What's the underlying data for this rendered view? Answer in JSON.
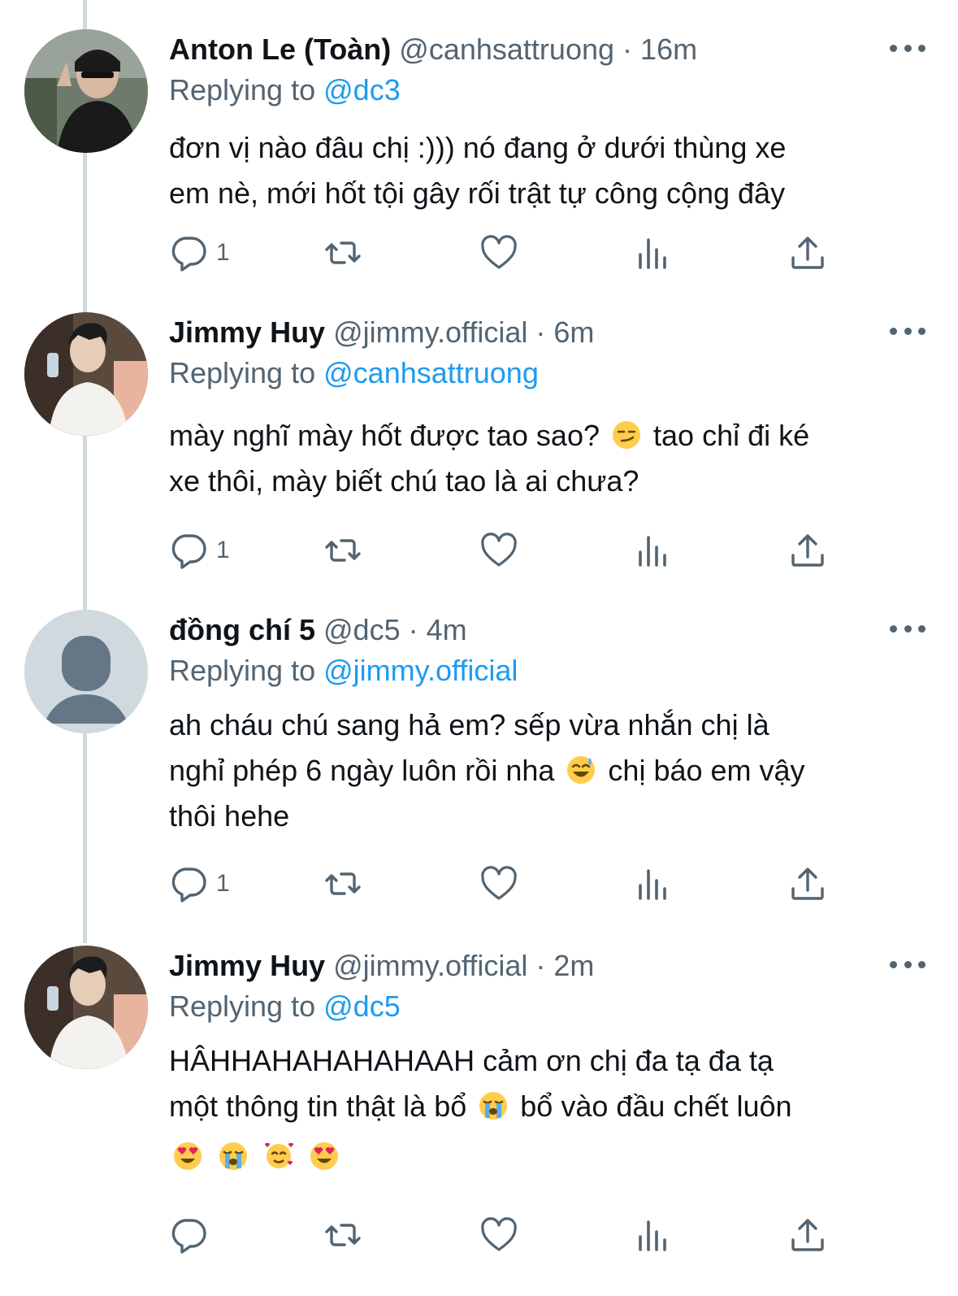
{
  "tweets": [
    {
      "name": "Anton Le (Toàn)",
      "handle": "@canhsattruong",
      "separator": "·",
      "time": "16m",
      "replying_prefix": "Replying to",
      "replying_to": "@dc3",
      "lines": [
        "đơn vị nào đâu chị :))) nó đang ở dưới thùng xe",
        "em nè, mới hốt tội gây rối trật tự công cộng đây"
      ],
      "reply_count": "1",
      "avatar": "photo"
    },
    {
      "name": "Jimmy Huy",
      "handle": "@jimmy.official",
      "separator": "·",
      "time": "6m",
      "replying_prefix": "Replying to",
      "replying_to": "@canhsattruong",
      "lines": [
        "mày nghĩ mày hốt được tao sao?",
        "tao chỉ đi ké",
        "xe thôi, mày biết chú tao là ai chưa?"
      ],
      "reply_count": "1",
      "avatar": "photo"
    },
    {
      "name": "đồng chí 5",
      "handle": "@dc5",
      "separator": "·",
      "time": "4m",
      "replying_prefix": "Replying to",
      "replying_to": "@jimmy.official",
      "lines": [
        "ah cháu chú sang hả em? sếp vừa nhắn chị là",
        "nghỉ phép 6 ngày luôn rồi nha",
        "chị báo em vậy",
        "thôi hehe"
      ],
      "reply_count": "1",
      "avatar": "default"
    },
    {
      "name": "Jimmy Huy",
      "handle": "@jimmy.official",
      "separator": "·",
      "time": "2m",
      "replying_prefix": "Replying to",
      "replying_to": "@dc5",
      "lines": [
        "HÂHHAHAHAHAHAAH cảm ơn chị đa tạ đa tạ",
        "một thông tin thật là bổ",
        "bổ vào đầu chết luôn"
      ],
      "reply_count": "",
      "avatar": "photo"
    }
  ],
  "icons": {
    "reply": "reply-icon",
    "retweet": "retweet-icon",
    "like": "heart-icon",
    "views": "views-icon",
    "share": "share-icon",
    "more": "more-icon"
  },
  "colors": {
    "link": "#1d9bf0",
    "secondary": "#536471",
    "thread_line": "#cfd9de"
  }
}
